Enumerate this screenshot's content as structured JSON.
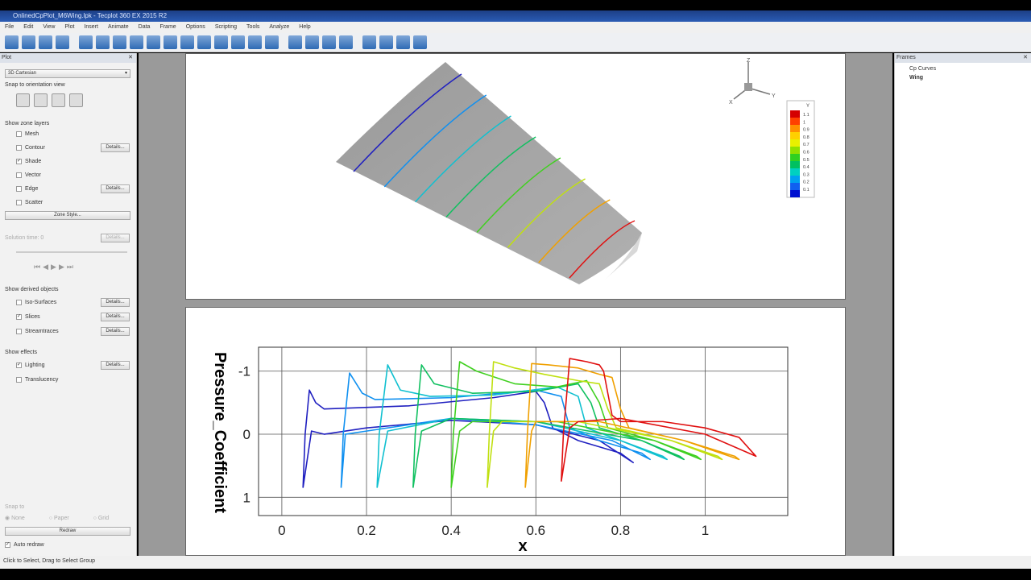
{
  "window": {
    "title": "OnlinedCpPlot_M6Wing.lpk - Tecplot 360 EX 2015 R2"
  },
  "menu": [
    "File",
    "Edit",
    "View",
    "Plot",
    "Insert",
    "Animate",
    "Data",
    "Frame",
    "Options",
    "Scripting",
    "Tools",
    "Analyze",
    "Help"
  ],
  "left_panel": {
    "title": "Plot",
    "plot_type": "3D Cartesian",
    "snap_label": "Snap to orientation view",
    "zone_layers_label": "Show zone layers",
    "layers": [
      {
        "label": "Mesh",
        "checked": false
      },
      {
        "label": "Contour",
        "checked": false,
        "details": "Details..."
      },
      {
        "label": "Shade",
        "checked": true
      },
      {
        "label": "Vector",
        "checked": false
      },
      {
        "label": "Edge",
        "checked": false,
        "details": "Details..."
      },
      {
        "label": "Scatter",
        "checked": false
      }
    ],
    "zone_style": "Zone Style...",
    "solution_time": "Solution time: 0",
    "details": "Details...",
    "derived_label": "Show derived objects",
    "derived": [
      {
        "label": "Iso-Surfaces",
        "checked": false
      },
      {
        "label": "Slices",
        "checked": true
      },
      {
        "label": "Streamtraces",
        "checked": false
      }
    ],
    "effects_label": "Show effects",
    "effects": [
      {
        "label": "Lighting",
        "checked": true
      },
      {
        "label": "Translucency",
        "checked": false
      }
    ],
    "snap_to": "Snap to",
    "snap_options": [
      "None",
      "Paper",
      "Grid"
    ],
    "redraw": "Redraw",
    "auto_redraw": "Auto redraw"
  },
  "frames_panel": {
    "title": "Frames",
    "items": [
      "Cp Curves",
      "Wing"
    ]
  },
  "axis_triad": {
    "x": "X",
    "y": "Y",
    "z": "Z"
  },
  "legend": {
    "title": "Y",
    "levels": [
      "1.1",
      "1",
      "0.9",
      "0.8",
      "0.7",
      "0.6",
      "0.5",
      "0.4",
      "0.3",
      "0.2",
      "0.1"
    ],
    "colors": [
      "#d40000",
      "#ff4000",
      "#ff9000",
      "#ffd000",
      "#e8f000",
      "#90e000",
      "#30d020",
      "#00c060",
      "#00d0c0",
      "#00a0f0",
      "#1060f0",
      "#0010d0"
    ]
  },
  "status": "Click to Select, Drag to Select Group",
  "chart_data": {
    "type": "line",
    "xlabel": "x",
    "ylabel": "Pressure_Coefficient",
    "xlim": [
      -0.055,
      1.195
    ],
    "ylim": [
      1.29,
      -1.38
    ],
    "y_inverted": true,
    "xticks": [
      "0",
      "0.2",
      "0.4",
      "0.6",
      "0.8",
      "1"
    ],
    "xtick_values": [
      0,
      0.2,
      0.4,
      0.6,
      0.8,
      1
    ],
    "yticks": [
      "-1",
      "0",
      "1"
    ],
    "ytick_values": [
      -1,
      0,
      1
    ],
    "grid": true,
    "series": [
      {
        "color": "#2020c0",
        "points": [
          [
            0.05,
            0.85
          ],
          [
            0.055,
            0
          ],
          [
            0.065,
            -0.7
          ],
          [
            0.08,
            -0.5
          ],
          [
            0.1,
            -0.4
          ],
          [
            0.3,
            -0.45
          ],
          [
            0.5,
            -0.58
          ],
          [
            0.6,
            -0.68
          ],
          [
            0.62,
            -0.5
          ],
          [
            0.64,
            -0.1
          ],
          [
            0.7,
            0.1
          ],
          [
            0.8,
            0.3
          ],
          [
            0.83,
            0.45
          ],
          [
            0.75,
            0.1
          ],
          [
            0.6,
            -0.15
          ],
          [
            0.4,
            -0.22
          ],
          [
            0.2,
            -0.1
          ],
          [
            0.1,
            0.0
          ],
          [
            0.07,
            -0.05
          ],
          [
            0.05,
            0.85
          ]
        ]
      },
      {
        "color": "#1090f0",
        "points": [
          [
            0.14,
            0.85
          ],
          [
            0.145,
            0
          ],
          [
            0.16,
            -0.97
          ],
          [
            0.19,
            -0.65
          ],
          [
            0.22,
            -0.55
          ],
          [
            0.4,
            -0.58
          ],
          [
            0.6,
            -0.7
          ],
          [
            0.66,
            -0.6
          ],
          [
            0.68,
            -0.1
          ],
          [
            0.75,
            0.1
          ],
          [
            0.85,
            0.3
          ],
          [
            0.87,
            0.4
          ],
          [
            0.78,
            0.1
          ],
          [
            0.6,
            -0.15
          ],
          [
            0.4,
            -0.25
          ],
          [
            0.2,
            -0.05
          ],
          [
            0.15,
            0
          ],
          [
            0.14,
            0.85
          ]
        ]
      },
      {
        "color": "#10c0d0",
        "points": [
          [
            0.225,
            0.85
          ],
          [
            0.23,
            0
          ],
          [
            0.25,
            -1.1
          ],
          [
            0.28,
            -0.7
          ],
          [
            0.35,
            -0.6
          ],
          [
            0.5,
            -0.62
          ],
          [
            0.65,
            -0.75
          ],
          [
            0.7,
            -0.6
          ],
          [
            0.72,
            -0.1
          ],
          [
            0.8,
            0.1
          ],
          [
            0.9,
            0.35
          ],
          [
            0.91,
            0.4
          ],
          [
            0.8,
            0.1
          ],
          [
            0.6,
            -0.2
          ],
          [
            0.4,
            -0.25
          ],
          [
            0.25,
            -0.05
          ],
          [
            0.225,
            0.85
          ]
        ]
      },
      {
        "color": "#10c060",
        "points": [
          [
            0.31,
            0.85
          ],
          [
            0.315,
            0
          ],
          [
            0.33,
            -1.1
          ],
          [
            0.36,
            -0.8
          ],
          [
            0.45,
            -0.65
          ],
          [
            0.6,
            -0.68
          ],
          [
            0.7,
            -0.8
          ],
          [
            0.73,
            -0.5
          ],
          [
            0.75,
            -0.1
          ],
          [
            0.85,
            0.1
          ],
          [
            0.94,
            0.35
          ],
          [
            0.95,
            0.4
          ],
          [
            0.85,
            0.1
          ],
          [
            0.6,
            -0.2
          ],
          [
            0.4,
            -0.25
          ],
          [
            0.33,
            -0.05
          ],
          [
            0.31,
            0.85
          ]
        ]
      },
      {
        "color": "#40d020",
        "points": [
          [
            0.4,
            0.85
          ],
          [
            0.405,
            0
          ],
          [
            0.42,
            -1.15
          ],
          [
            0.46,
            -1.0
          ],
          [
            0.55,
            -0.8
          ],
          [
            0.65,
            -0.75
          ],
          [
            0.72,
            -0.85
          ],
          [
            0.75,
            -0.5
          ],
          [
            0.77,
            -0.1
          ],
          [
            0.88,
            0.1
          ],
          [
            0.98,
            0.35
          ],
          [
            0.99,
            0.4
          ],
          [
            0.88,
            0.1
          ],
          [
            0.65,
            -0.2
          ],
          [
            0.45,
            -0.2
          ],
          [
            0.42,
            -0.05
          ],
          [
            0.4,
            0.85
          ]
        ]
      },
      {
        "color": "#c0e010",
        "points": [
          [
            0.485,
            0.85
          ],
          [
            0.49,
            0
          ],
          [
            0.5,
            -1.15
          ],
          [
            0.55,
            -1.05
          ],
          [
            0.62,
            -0.95
          ],
          [
            0.7,
            -0.85
          ],
          [
            0.75,
            -0.8
          ],
          [
            0.77,
            -0.4
          ],
          [
            0.79,
            -0.1
          ],
          [
            0.92,
            0.1
          ],
          [
            1.03,
            0.35
          ],
          [
            1.04,
            0.4
          ],
          [
            0.92,
            0.1
          ],
          [
            0.7,
            -0.2
          ],
          [
            0.52,
            -0.2
          ],
          [
            0.5,
            -0.05
          ],
          [
            0.485,
            0.85
          ]
        ]
      },
      {
        "color": "#f0a000",
        "points": [
          [
            0.575,
            0.85
          ],
          [
            0.58,
            0
          ],
          [
            0.59,
            -1.12
          ],
          [
            0.63,
            -1.1
          ],
          [
            0.7,
            -1.05
          ],
          [
            0.75,
            -0.95
          ],
          [
            0.78,
            -0.9
          ],
          [
            0.8,
            -0.4
          ],
          [
            0.82,
            -0.1
          ],
          [
            0.95,
            0.1
          ],
          [
            1.07,
            0.35
          ],
          [
            1.08,
            0.4
          ],
          [
            0.95,
            0.1
          ],
          [
            0.75,
            -0.2
          ],
          [
            0.6,
            -0.2
          ],
          [
            0.59,
            -0.05
          ],
          [
            0.575,
            0.85
          ]
        ]
      },
      {
        "color": "#e01010",
        "points": [
          [
            0.66,
            0.75
          ],
          [
            0.665,
            0
          ],
          [
            0.68,
            -1.2
          ],
          [
            0.72,
            -1.15
          ],
          [
            0.75,
            -1.1
          ],
          [
            0.76,
            -1.0
          ],
          [
            0.78,
            -0.3
          ],
          [
            0.8,
            -0.2
          ],
          [
            0.9,
            -0.2
          ],
          [
            1.0,
            -0.1
          ],
          [
            1.08,
            0.05
          ],
          [
            1.12,
            0.35
          ],
          [
            1.0,
            0.0
          ],
          [
            0.8,
            -0.25
          ],
          [
            0.7,
            -0.2
          ],
          [
            0.68,
            -0.1
          ],
          [
            0.66,
            0.75
          ]
        ]
      }
    ]
  }
}
